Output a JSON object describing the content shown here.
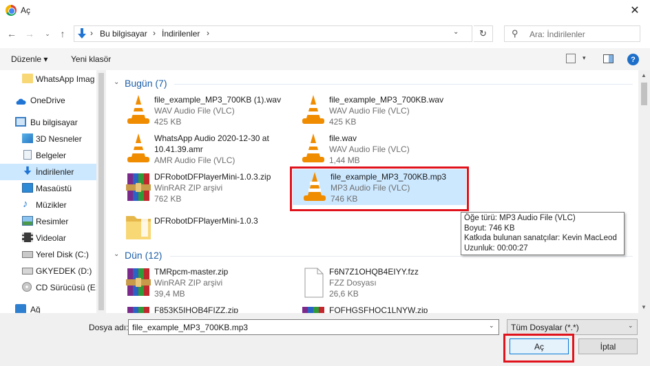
{
  "window": {
    "title": "Aç",
    "close_icon": "close-icon"
  },
  "address": {
    "crumbs": [
      "Bu bilgisayar",
      "İndirilenler"
    ],
    "search_placeholder": "Ara: İndirilenler"
  },
  "toolbar": {
    "organize": "Düzenle ▾",
    "new_folder": "Yeni klasör",
    "help": "?"
  },
  "nav": {
    "items": [
      {
        "label": "WhatsApp Imag",
        "icon": "folder-icon"
      },
      {
        "label": "OneDrive",
        "icon": "cloud-icon"
      },
      {
        "label": "Bu bilgisayar",
        "icon": "computer-icon"
      },
      {
        "label": "3D Nesneler",
        "icon": "3d-objects-icon"
      },
      {
        "label": "Belgeler",
        "icon": "documents-icon"
      },
      {
        "label": "İndirilenler",
        "icon": "downloads-icon"
      },
      {
        "label": "Masaüstü",
        "icon": "desktop-icon"
      },
      {
        "label": "Müzikler",
        "icon": "music-icon"
      },
      {
        "label": "Resimler",
        "icon": "pictures-icon"
      },
      {
        "label": "Videolar",
        "icon": "videos-icon"
      },
      {
        "label": "Yerel Disk (C:)",
        "icon": "local-disk-icon"
      },
      {
        "label": "GKYEDEK (D:)",
        "icon": "drive-icon"
      },
      {
        "label": "CD Sürücüsü (E:)",
        "icon": "cd-drive-icon"
      },
      {
        "label": "Ağ",
        "icon": "network-icon"
      }
    ]
  },
  "groups": [
    {
      "header": "Bugün (7)"
    },
    {
      "header": "Dün (12)"
    }
  ],
  "files": [
    {
      "name": "file_example_MP3_700KB (1).wav",
      "type": "WAV Audio File (VLC)",
      "size": "425 KB",
      "icon": "vlc-icon"
    },
    {
      "name": "file_example_MP3_700KB.wav",
      "type": "WAV Audio File (VLC)",
      "size": "425 KB",
      "icon": "vlc-icon"
    },
    {
      "name": "WhatsApp Audio 2020-12-30 at",
      "name2": "10.41.39.amr",
      "type": "AMR Audio File (VLC)",
      "icon": "vlc-icon"
    },
    {
      "name": "file.wav",
      "type": "WAV Audio File (VLC)",
      "size": "1,44 MB",
      "icon": "vlc-icon"
    },
    {
      "name": "DFRobotDFPlayerMini-1.0.3.zip",
      "type": "WinRAR ZIP arşivi",
      "size": "762 KB",
      "icon": "winrar-icon"
    },
    {
      "name": "file_example_MP3_700KB.mp3",
      "type": "MP3 Audio File (VLC)",
      "size": "746 KB",
      "icon": "vlc-icon"
    },
    {
      "name": "DFRobotDFPlayerMini-1.0.3",
      "icon": "folder-icon"
    },
    {
      "name": "TMRpcm-master.zip",
      "type": "WinRAR ZIP arşivi",
      "size": "39,4 MB",
      "icon": "winrar-icon"
    },
    {
      "name": "F6N7Z1OHQB4EIYY.fzz",
      "type": "FZZ Dosyası",
      "size": "26,6 KB",
      "icon": "blank-file-icon"
    },
    {
      "name": "F853K5IHOB4FIZZ.zip",
      "icon": "winrar-icon"
    },
    {
      "name": "FOFHGSFHOC1LNYW.zip",
      "icon": "winrar-icon"
    }
  ],
  "tooltip": {
    "line1": "Öğe türü: MP3 Audio File (VLC)",
    "line2": "Boyut: 746 KB",
    "line3": "Katkıda bulunan sanatçılar: Kevin MacLeod",
    "line4": "Uzunluk: 00:00:27"
  },
  "bottom": {
    "filename_label": "Dosya adı:",
    "filename_value": "file_example_MP3_700KB.mp3",
    "filter_value": "Tüm Dosyalar (*.*)",
    "open_label": "Aç",
    "cancel_label": "İptal"
  },
  "colors": {
    "highlight": "#e0121b",
    "selection": "#cce8ff",
    "accent": "#0078d7"
  }
}
